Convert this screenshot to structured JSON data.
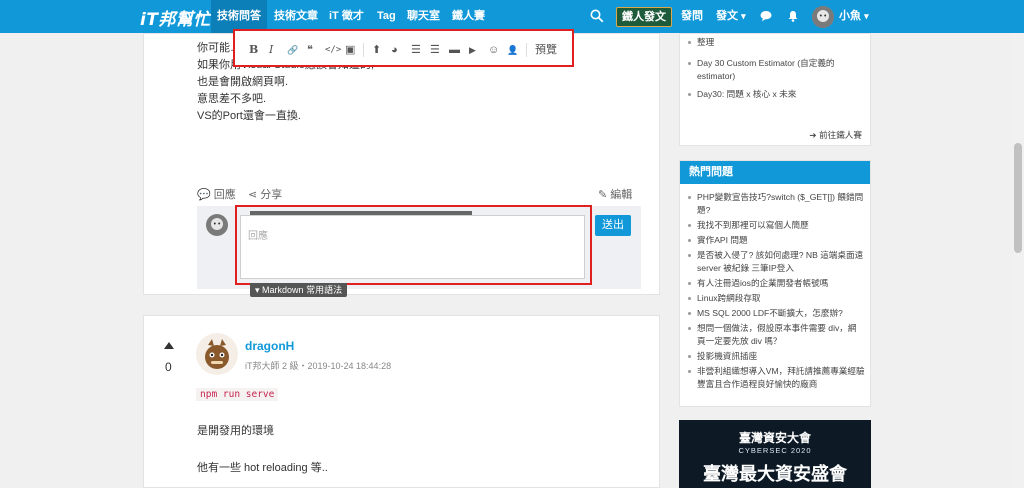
{
  "nav": {
    "logo": "iT邦幫忙",
    "links": [
      "技術問答",
      "技術文章",
      "iT 徵才",
      "Tag",
      "聊天室",
      "鐵人賽"
    ],
    "ironman_button": "鐵人發文",
    "ask": "發問",
    "post": "發文",
    "username": "小魚",
    "caret": "▾"
  },
  "toolbar": {
    "bold": "B",
    "italic": "I",
    "link": "🔗",
    "quote": "❝",
    "code": "</>",
    "image": "▣",
    "upload": "⬆",
    "chart": "◕",
    "ol": "☰",
    "ul": "☰",
    "hr": "▬",
    "video": "▶",
    "emoji": "☺",
    "user": "👤",
    "preview": "預覽"
  },
  "post": {
    "lines": [
      "你可能…",
      "如果你用Visual Studio應該會知道的,",
      "也是會開啟網頁啊.",
      "意思差不多吧.",
      "VS的Port還會一直換."
    ]
  },
  "actions": {
    "reply": "回應",
    "share": "分享",
    "edit": "編輯"
  },
  "reply_box": {
    "placeholder": "回應",
    "send": "送出",
    "markdown_tab": "Markdown 常用語法"
  },
  "answer": {
    "vote_count": "0",
    "author": "dragonH",
    "meta": "iT邦大師 2 級・2019-10-24 18:44:28",
    "code": "npm run serve",
    "line1": "是開發用的環境",
    "line2": "他有一些 hot reloading 等.."
  },
  "sidebar": {
    "ironman_items": [
      "整理",
      "Day 30 Custom Estimator (自定義的 estimator)",
      "Day30: 問題 x 核心 x 未來"
    ],
    "ironman_more": "前往鐵人賽",
    "hot_title": "熱門問題",
    "hot_items": [
      "PHP變數宣告技巧?switch ($_GET[]) 餵錯問題?",
      "我找不到那裡可以寫個人簡歷",
      "實作API 問題",
      "是否被入侵了? 該如何處理? NB 這端桌面遠server 被紀錄 三筆IP登入",
      "有人注冊過ios的企業開發者帳號嗎",
      "Linux跨網段存取",
      "MS SQL 2000 LDF不斷擴大，怎麼辦?",
      "想問一個做法，假設原本事件需要 div，網頁一定要先放 div 嗎？",
      "投影機資訊插座",
      "非營利組織想導入VM，拜託請推薦專業經驗豐富且合作過程良好愉快的廠商"
    ]
  },
  "banner": {
    "title": "臺灣資安大會",
    "subtitle": "CYBERSEC 2020",
    "big": "臺灣最大資安盛會"
  },
  "colors": {
    "brand": "#1098d9",
    "highlight": "#e02020"
  }
}
